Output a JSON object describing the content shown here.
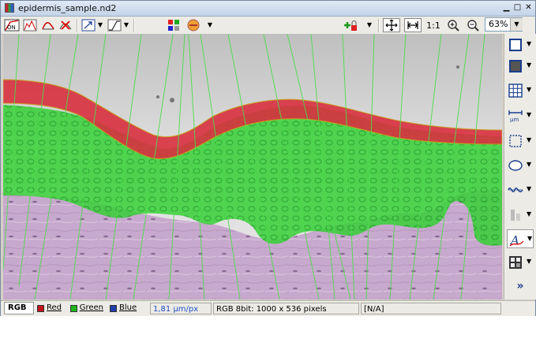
{
  "window": {
    "title": "epidermis_sample.nd2",
    "controls": {
      "minimize": "▁",
      "maximize": "□",
      "close": "✕"
    }
  },
  "toolbar": {
    "lut_button": "ON",
    "one_to_one": "1:1",
    "zoom_value": "63%",
    "icons": [
      "lut-on-icon",
      "histogram-icon",
      "curve-icon",
      "remove-curve-icon",
      "auto-contrast-icon",
      "gamma-curve-icon",
      "channels-icon",
      "color-picker-icon",
      "lock-add-icon",
      "fit-to-screen-icon",
      "fit-width-icon",
      "zoom-in-icon",
      "zoom-out-icon"
    ]
  },
  "sidebar": {
    "tools": [
      "rectangle-roi-icon",
      "overlay-icon",
      "grid-icon",
      "scale-bar-icon",
      "crop-icon",
      "ellipse-roi-icon",
      "profile-icon",
      "sliders-icon",
      "annotation-text-icon",
      "view-mode-icon"
    ],
    "more": "»"
  },
  "statusbar": {
    "channels": [
      {
        "label": "RGB",
        "color": ""
      },
      {
        "label": "Red",
        "color": "#c0151c"
      },
      {
        "label": "Green",
        "color": "#1fb51f"
      },
      {
        "label": "Blue",
        "color": "#1f3fa8"
      }
    ],
    "calibration": "1,81 µm/px",
    "image_info": "RGB 8bit: 1000 x 536 pixels",
    "extra": "[N/A]"
  },
  "colors": {
    "stratum_corneum": "#d8303f",
    "epidermis_overlay": "#2fd12f",
    "dermis": "#c6a8cc",
    "measure_lines": "#4cdc4c",
    "calibration_text": "#1f50c8"
  }
}
